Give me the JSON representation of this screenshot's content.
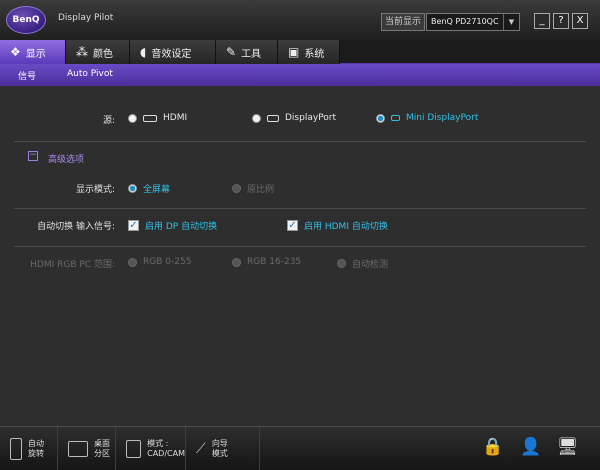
{
  "app": {
    "logo": "BenQ",
    "title": "Display Pilot"
  },
  "monitor": {
    "label": "当前显示",
    "selected": "BenQ PD2710QC"
  },
  "window_buttons": [
    "_",
    "?",
    "X"
  ],
  "tabs": [
    {
      "label": "显示",
      "icon": "display-gear-icon"
    },
    {
      "label": "颜色",
      "icon": "color-dots-icon"
    },
    {
      "label": "音效设定",
      "icon": "speaker-icon"
    },
    {
      "label": "工具",
      "icon": "wrench-icon"
    },
    {
      "label": "系统",
      "icon": "system-icon"
    }
  ],
  "subtabs": [
    "信号",
    "Auto Pivot"
  ],
  "source": {
    "label": "源:",
    "options": [
      "HDMI",
      "DisplayPort",
      "Mini DisplayPort"
    ],
    "selected": "Mini DisplayPort"
  },
  "advanced": {
    "toggle": "−",
    "title": "高级选项",
    "display_mode": {
      "label": "显示模式:",
      "options": [
        "全屏幕",
        "原比例"
      ],
      "selected": "全屏幕"
    },
    "auto_switch": {
      "label": "自动切换 输入信号:",
      "options": [
        "启用 DP 自动切换",
        "启用 HDMI 自动切换"
      ]
    },
    "rgb_range": {
      "label": "HDMI RGB PC 范围:",
      "options": [
        "RGB 0-255",
        "RGB 16-235",
        "自动检测"
      ]
    }
  },
  "bottom": {
    "buttons": [
      {
        "line1": "自动",
        "line2": "旋转"
      },
      {
        "line1": "桌面",
        "line2": "分区"
      },
      {
        "line1": "模式 :",
        "line2": "CAD/CAM"
      },
      {
        "line1": "向导",
        "line2": "模式"
      }
    ],
    "icons": [
      "🔒",
      "👤",
      "🖥"
    ]
  },
  "colors": {
    "accent": "#6a4bc6",
    "cyan": "#2fc0e6"
  }
}
